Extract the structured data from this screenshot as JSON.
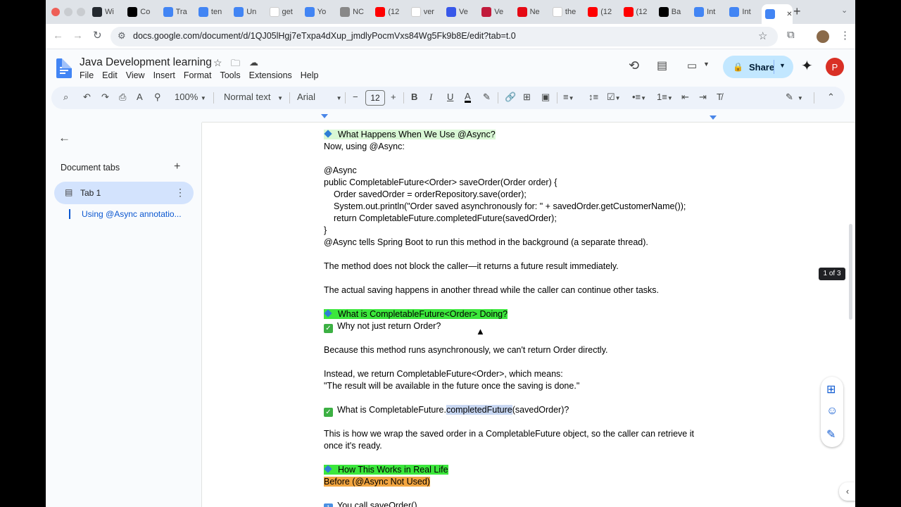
{
  "browser": {
    "tabs": [
      {
        "title": "Wi",
        "favicon": "github-icon",
        "color": "#24292f"
      },
      {
        "title": "Co",
        "favicon": "chatgpt-icon",
        "color": "#000000"
      },
      {
        "title": "Tra",
        "favicon": "docs-icon",
        "color": "#4285f4"
      },
      {
        "title": "ten",
        "favicon": "docs-icon",
        "color": "#4285f4"
      },
      {
        "title": "Un",
        "favicon": "docs-icon",
        "color": "#4285f4"
      },
      {
        "title": "get",
        "favicon": "google-icon",
        "color": "#ffffff"
      },
      {
        "title": "Yo",
        "favicon": "bookmark-icon",
        "color": "#4285f4"
      },
      {
        "title": "NC",
        "favicon": "globe-icon",
        "color": "#888888"
      },
      {
        "title": "(12",
        "favicon": "youtube-icon",
        "color": "#ff0000"
      },
      {
        "title": "ver",
        "favicon": "google-icon",
        "color": "#ffffff"
      },
      {
        "title": "Ve",
        "favicon": "wordpress-icon",
        "color": "#3858e9"
      },
      {
        "title": "Ve",
        "favicon": "mascot-icon",
        "color": "#c11b3b"
      },
      {
        "title": "Ne",
        "favicon": "netflix-icon",
        "color": "#e50914"
      },
      {
        "title": "the",
        "favicon": "google-icon",
        "color": "#ffffff"
      },
      {
        "title": "(12",
        "favicon": "youtube-icon",
        "color": "#ff0000"
      },
      {
        "title": "(12",
        "favicon": "youtube-icon",
        "color": "#ff0000"
      },
      {
        "title": "Ba",
        "favicon": "chatgpt-icon",
        "color": "#000000"
      },
      {
        "title": "Int",
        "favicon": "docs-icon",
        "color": "#4285f4"
      },
      {
        "title": "Int",
        "favicon": "docs-icon",
        "color": "#4285f4"
      },
      {
        "title": "",
        "favicon": "docs-icon",
        "color": "#4285f4",
        "active": true
      }
    ],
    "new_tab": "+",
    "url": "docs.google.com/document/d/1QJ05lHgj7eTxpa4dXup_jmdlyPocmVxs84Wg5Fk9b8E/edit?tab=t.0"
  },
  "docs": {
    "title": "Java Development learning",
    "menu": [
      "File",
      "Edit",
      "View",
      "Insert",
      "Format",
      "Tools",
      "Extensions",
      "Help"
    ],
    "share_label": "Share",
    "avatar_letter": "P"
  },
  "format_toolbar": {
    "zoom": "100%",
    "style": "Normal text",
    "font": "Arial",
    "font_size": "12"
  },
  "sidebar": {
    "heading": "Document tabs",
    "tab_label": "Tab 1",
    "outline_item": "Using @Async annotatio..."
  },
  "page_badge": "1 of 3",
  "document": {
    "h_async": "What Happens When We Use @Async?",
    "l1": "Now, using @Async:",
    "c1": "@Async",
    "c2": "public CompletableFuture<Order> saveOrder(Order order) {",
    "c3": "Order savedOrder = orderRepository.save(order);",
    "c4": "System.out.println(\"Order saved asynchronously for: \" + savedOrder.getCustomerName());",
    "c5": "return CompletableFuture.completedFuture(savedOrder);",
    "c6": "}",
    "l2": "@Async tells Spring Boot to run this method in the background (a separate thread).",
    "l3": "The method does not block the caller—it returns a future result immediately.",
    "l4": "The actual saving happens in another thread while the caller can continue other tasks.",
    "h_cf": "What is CompletableFuture<Order> Doing?",
    "q1": "Why not just return Order?",
    "l5": "Because this method runs asynchronously, we can't return Order directly.",
    "l6": "Instead, we return CompletableFuture<Order>, which means:",
    "l7": "\"The result will be available in the future once the saving is done.\"",
    "q2_a": "What is CompletableFuture.",
    "q2_sel": "completedFuture",
    "q2_b": "(savedOrder)?",
    "l8": "This is how we wrap the saved order in a CompletableFuture object, so the caller can retrieve it",
    "l9": "once it's ready.",
    "h_real": "How This Works in Real Life",
    "h_before": "Before (@Async Not Used)",
    "l10": "You call saveOrder()."
  }
}
